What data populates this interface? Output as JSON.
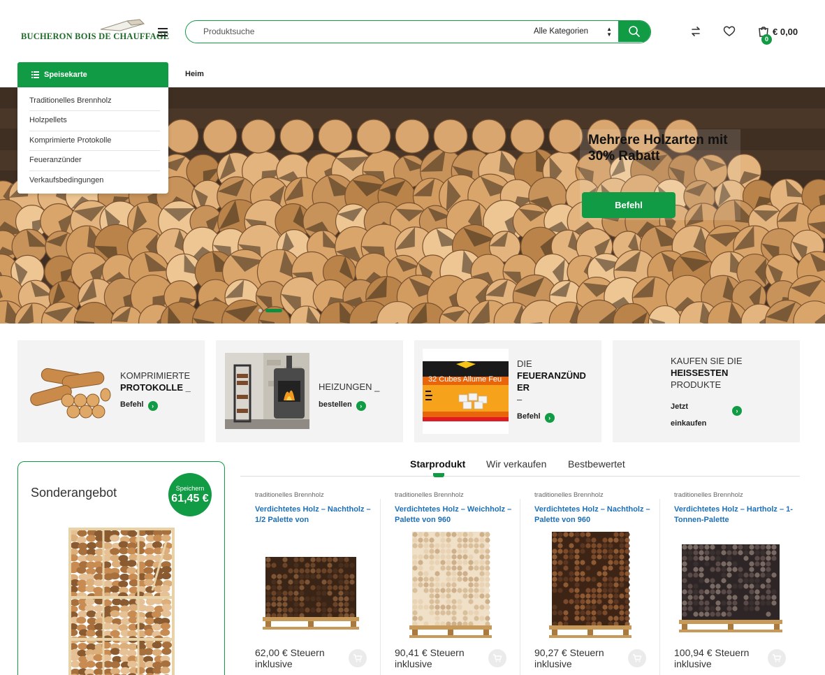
{
  "header": {
    "logo_text": "BUCHERON BOIS DE CHAUFFAGE",
    "search_placeholder": "Produktsuche",
    "category_select": "Alle Kategorien",
    "cart_total": "€ 0,00",
    "cart_count": "0"
  },
  "nav": {
    "menu_label": "Speisekarte",
    "home_label": "Heim",
    "menu_items": [
      "Traditionelles Brennholz",
      "Holzpellets",
      "Komprimierte Protokolle",
      "Feueranzünder",
      "Verkaufsbedingungen"
    ]
  },
  "hero": {
    "title": "Mehrere Holzarten mit 30% Rabatt",
    "button": "Befehl"
  },
  "categories": [
    {
      "line1": "KOMPRIMIERTE",
      "line2": "PROTOKOLLE _",
      "link": "Befehl"
    },
    {
      "line1": "HEIZUNGEN _",
      "link": "bestellen"
    },
    {
      "line1": "DIE",
      "line2": "FEUERANZÜND",
      "line3": "ER",
      "line4": "–",
      "link": "Befehl",
      "image_text": "32 Cubes Allume Feu"
    },
    {
      "line1": "KAUFEN SIE DIE",
      "line2": "HEISSESTEN",
      "line3": "PRODUKTE",
      "link_line1": "Jetzt",
      "link_line2": "einkaufen"
    }
  ],
  "special": {
    "title": "Sonderangebot",
    "badge_label": "Speichern",
    "badge_value": "61,45 €"
  },
  "tabs": [
    "Starprodukt",
    "Wir verkaufen",
    "Bestbewertet"
  ],
  "products": [
    {
      "category": "traditionelles Brennholz",
      "name": "Verdichtetes Holz – Nachtholz – 1/2 Palette von",
      "price": "62,00 € Steuern inklusive"
    },
    {
      "category": "traditionelles Brennholz",
      "name": "Verdichtetes Holz – Weichholz – Palette von 960",
      "price": "90,41 € Steuern inklusive"
    },
    {
      "category": "traditionelles Brennholz",
      "name": "Verdichtetes Holz – Nachtholz – Palette von 960",
      "price": "90,27 € Steuern inklusive"
    },
    {
      "category": "traditionelles Brennholz",
      "name": "Verdichtetes Holz – Hartholz – 1-Tonnen-Palette",
      "price": "100,94 € Steuern inklusive"
    }
  ],
  "colors": {
    "accent": "#129b45",
    "link_blue": "#1d6fb8"
  }
}
